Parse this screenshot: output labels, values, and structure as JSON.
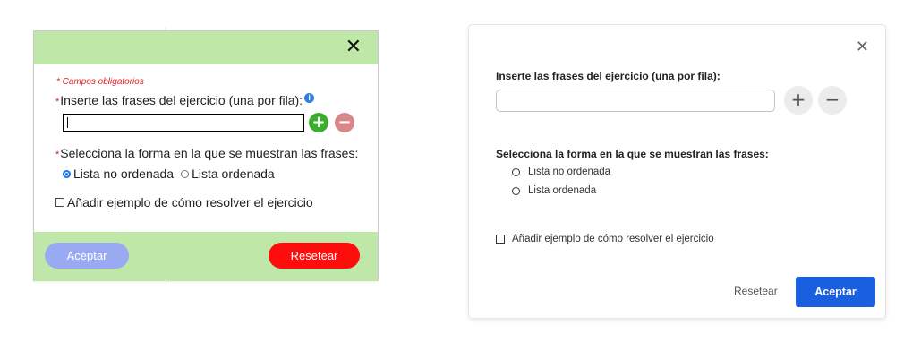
{
  "old_dialog": {
    "close_glyph": "✕",
    "required_note": "* Campos obligatorios",
    "required_star": "*",
    "phrases_label": "Inserte las frases del ejercicio (una por fila):",
    "info_glyph": "i",
    "input_value": "",
    "plus_glyph": "+",
    "minus_glyph": "−",
    "display_label": "Selecciona la forma en la que se muestran las frases:",
    "radio_options": [
      {
        "label": "Lista no ordenada",
        "checked": true
      },
      {
        "label": "Lista ordenada",
        "checked": false
      }
    ],
    "example_checkbox_label": "Añadir ejemplo de cómo resolver el ejercicio",
    "accept_label": "Aceptar",
    "reset_label": "Resetear",
    "colors": {
      "header": "#bfe8a8",
      "accept": "#9aaaf2",
      "reset": "#ff0d0d",
      "plus": "#3bae2e",
      "minus": "#d88888"
    }
  },
  "new_dialog": {
    "close_glyph": "✕",
    "phrases_label": "Inserte las frases del ejercicio (una por fila):",
    "input_value": "",
    "plus_glyph": "+",
    "minus_glyph": "−",
    "display_label": "Selecciona la forma en la que se muestran las frases:",
    "radio_options": [
      {
        "label": "Lista no ordenada",
        "checked": false
      },
      {
        "label": "Lista ordenada",
        "checked": false
      }
    ],
    "example_checkbox_label": "Añadir ejemplo de cómo resolver el ejercicio",
    "reset_label": "Resetear",
    "accept_label": "Aceptar",
    "colors": {
      "accept": "#1a5fe0"
    }
  }
}
